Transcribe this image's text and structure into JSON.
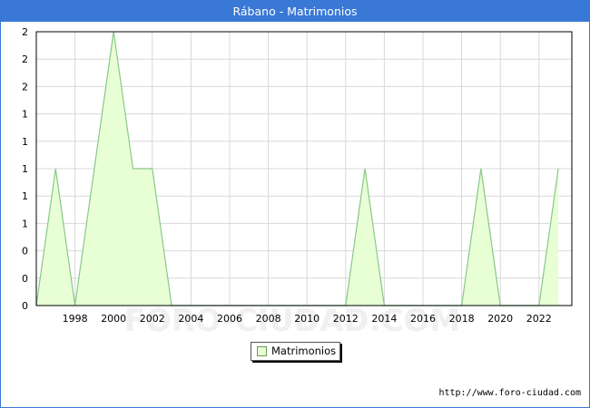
{
  "window": {
    "title": "Rábano - Matrimonios"
  },
  "watermark": "FORO-CIUDAD.COM",
  "source_url": "http://www.foro-ciudad.com",
  "legend": {
    "label": "Matrimonios"
  },
  "colors": {
    "title_bar": "#3a78d6",
    "area_fill": "#e8ffd5",
    "area_line": "#88c888",
    "grid": "#d8d8d8"
  },
  "chart_data": {
    "type": "area",
    "title": "Rábano - Matrimonios",
    "xlabel": "",
    "ylabel": "",
    "x": [
      1996,
      1997,
      1998,
      1999,
      2000,
      2001,
      2002,
      2003,
      2004,
      2005,
      2006,
      2007,
      2008,
      2009,
      2010,
      2011,
      2012,
      2013,
      2014,
      2015,
      2016,
      2017,
      2018,
      2019,
      2020,
      2021,
      2022,
      2023
    ],
    "series": [
      {
        "name": "Matrimonios",
        "values": [
          0,
          1,
          0,
          1,
          2,
          1,
          1,
          0,
          0,
          0,
          0,
          0,
          0,
          0,
          0,
          0,
          0,
          1,
          0,
          0,
          0,
          0,
          0,
          1,
          0,
          0,
          0,
          1
        ]
      }
    ],
    "x_ticks": [
      "1998",
      "2000",
      "2002",
      "2004",
      "2006",
      "2008",
      "2010",
      "2012",
      "2014",
      "2016",
      "2018",
      "2020",
      "2022"
    ],
    "y_tick_labels": [
      "0",
      "0",
      "0",
      "1",
      "1",
      "1",
      "1",
      "1",
      "2",
      "2",
      "2"
    ],
    "ylim": [
      0,
      2
    ],
    "xlim": [
      1996,
      2023
    ],
    "grid": true,
    "legend_position": "bottom-center"
  }
}
